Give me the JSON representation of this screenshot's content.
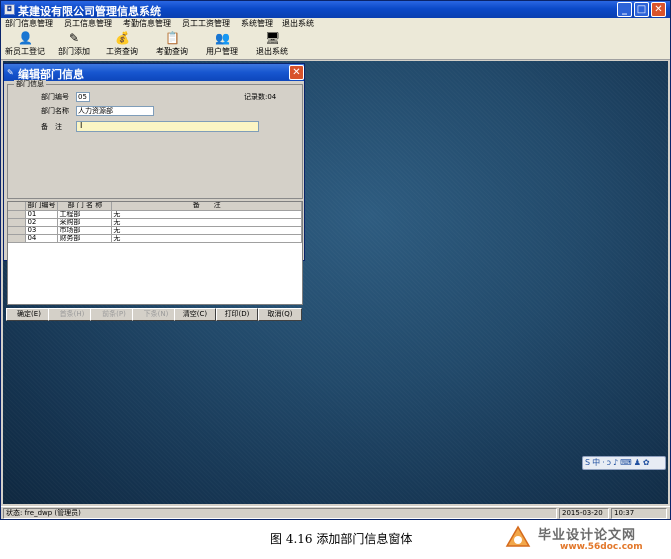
{
  "window": {
    "title": "某建设有限公司管理信息系统",
    "icon_name": "app-icon",
    "controls": {
      "minimize": "_",
      "maximize": "□",
      "close": "✕"
    }
  },
  "menu": [
    "部门信息管理",
    "员工信息管理",
    "考勤信息管理",
    "员工工资管理",
    "系统管理",
    "退出系统"
  ],
  "toolbar": [
    {
      "label": "新员工登记",
      "icon": "register-icon",
      "glyph": "👤"
    },
    {
      "label": "部门添加",
      "icon": "edit-icon",
      "glyph": "✎"
    },
    {
      "label": "工资查询",
      "icon": "salary-icon",
      "glyph": "💰"
    },
    {
      "label": "考勤查询",
      "icon": "attendance-icon",
      "glyph": "📋"
    },
    {
      "label": "用户管理",
      "icon": "users-icon",
      "glyph": "👥"
    },
    {
      "label": "退出系统",
      "icon": "exit-icon",
      "glyph": "🖥"
    }
  ],
  "dialog": {
    "title": "编辑部门信息",
    "icon_glyph": "✎",
    "close_glyph": "✕",
    "group_label": "部门信息",
    "dept_id_label": "部门编号",
    "dept_id_value": "05",
    "record_count": "记录数:04",
    "dept_name_label": "部门名称",
    "dept_name_value": "人力资源部",
    "remark_label": "备　注",
    "remark_value": "",
    "cursor_glyph": "I",
    "grid": {
      "headers": [
        "部门编号",
        "部 门 名 称",
        "备　　注"
      ],
      "rows": [
        [
          "01",
          "工程部",
          "无"
        ],
        [
          "02",
          "采购部",
          "无"
        ],
        [
          "03",
          "市场部",
          "无"
        ],
        [
          "04",
          "财务部",
          "无"
        ]
      ]
    },
    "buttons": [
      {
        "label": "确定(E)",
        "enabled": true
      },
      {
        "label": "首条(H)",
        "enabled": false
      },
      {
        "label": "前条(P)",
        "enabled": false
      },
      {
        "label": "下条(N)",
        "enabled": false
      },
      {
        "label": "清空(C)",
        "enabled": true
      },
      {
        "label": "打印(D)",
        "enabled": true
      },
      {
        "label": "取消(Q)",
        "enabled": true
      }
    ]
  },
  "ime_bar": [
    "S",
    "中",
    "·",
    "ɔ",
    "♪",
    "⌨",
    "♟",
    "✿"
  ],
  "status": {
    "state": "状态: fre_dwp  (管理员)",
    "date": "2015-03-20",
    "time": "10:37"
  },
  "caption": "图 4.16 添加部门信息窗体",
  "watermark": {
    "title": "毕业设计论文网",
    "url": "www.56doc.com"
  },
  "colors": {
    "titlebar": "#0b49c8",
    "desktop": "#224a6b",
    "close_button": "#d8532b",
    "remark_field": "#fbf5c4",
    "watermark_url": "#e2772a"
  }
}
